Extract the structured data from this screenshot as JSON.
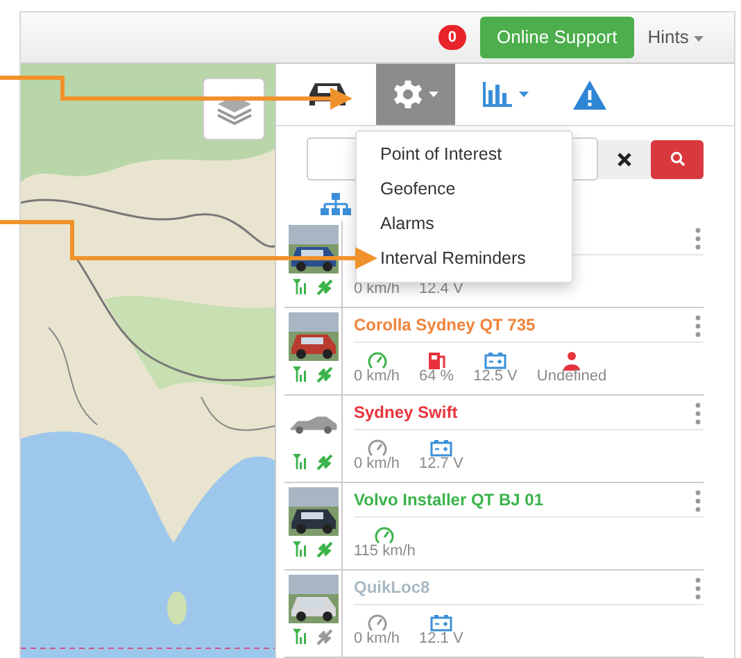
{
  "top_bar": {
    "notification_count": "0",
    "support_button": "Online Support",
    "hints_menu": "Hints"
  },
  "toolbar": [
    {
      "kind": "vehicles",
      "selected": false,
      "has_menu": false
    },
    {
      "kind": "settings",
      "selected": true,
      "has_menu": true
    },
    {
      "kind": "reports",
      "selected": false,
      "has_menu": true
    },
    {
      "kind": "alerts",
      "selected": false,
      "has_menu": false
    }
  ],
  "settings_menu": [
    "Point of Interest",
    "Geofence",
    "Alarms",
    "Interval Reminders"
  ],
  "vehicles": [
    {
      "photo": true,
      "signal": true,
      "gps_fix": true,
      "metrics": [
        {
          "value": "0 km/h"
        },
        {
          "value": "12.4 V"
        }
      ]
    },
    {
      "name": "Corolla Sydney QT 735",
      "color": "#f0833a",
      "photo": true,
      "signal": true,
      "gps_fix": true,
      "metrics": [
        {
          "kind": "speed",
          "color": "#3bb34a",
          "value": "0 km/h"
        },
        {
          "kind": "fuel",
          "color": "#e8333c",
          "value": "64 %"
        },
        {
          "kind": "battery",
          "color": "#3a8fd8",
          "value": "12.5 V"
        },
        {
          "kind": "driver",
          "color": "#e8333c",
          "value": "Undefined"
        }
      ]
    },
    {
      "name": "Sydney Swift",
      "color": "#e8333c",
      "photo": false,
      "signal": true,
      "gps_fix": true,
      "metrics": [
        {
          "kind": "speed",
          "color": "#999999",
          "value": "0 km/h"
        },
        {
          "kind": "battery",
          "color": "#3a8fd8",
          "value": "12.7 V"
        }
      ]
    },
    {
      "name": "Volvo Installer QT BJ 01",
      "color": "#3bb34a",
      "photo": true,
      "signal": true,
      "gps_fix": true,
      "metrics": [
        {
          "kind": "speed",
          "color": "#3bb34a",
          "value": "115 km/h"
        }
      ]
    },
    {
      "name": "QuikLoc8",
      "color": "#a9b9c4",
      "photo": true,
      "signal": true,
      "gps_fix": false,
      "metrics": [
        {
          "kind": "speed",
          "color": "#999999",
          "value": "0 km/h"
        },
        {
          "kind": "battery",
          "color": "#3a8fd8",
          "value": "12.1 V"
        }
      ]
    }
  ]
}
